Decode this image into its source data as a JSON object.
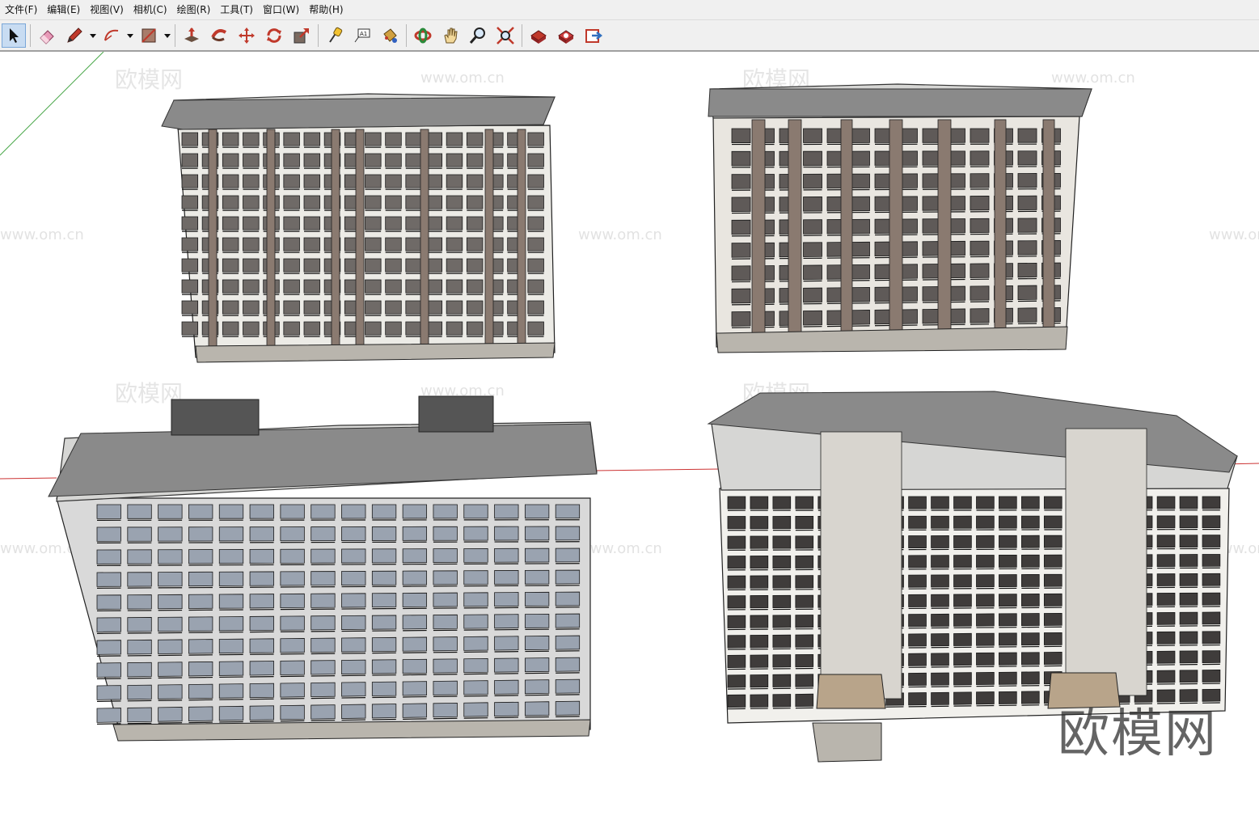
{
  "menu": [
    "文件(F)",
    "编辑(E)",
    "视图(V)",
    "相机(C)",
    "绘图(R)",
    "工具(T)",
    "窗口(W)",
    "帮助(H)"
  ],
  "toolbar": {
    "tools": [
      {
        "name": "select-icon",
        "active": true
      },
      {
        "name": "eraser-icon"
      },
      {
        "name": "pencil-icon",
        "dropdown": true
      },
      {
        "name": "arc-icon",
        "dropdown": true
      },
      {
        "name": "rectangle-icon",
        "dropdown": true
      },
      {
        "name": "push-pull-icon"
      },
      {
        "name": "follow-me-icon"
      },
      {
        "name": "move-icon"
      },
      {
        "name": "rotate-icon"
      },
      {
        "name": "scale-icon"
      },
      {
        "name": "tape-measure-icon"
      },
      {
        "name": "text-icon"
      },
      {
        "name": "paint-bucket-icon"
      },
      {
        "name": "orbit-icon"
      },
      {
        "name": "pan-icon"
      },
      {
        "name": "zoom-icon"
      },
      {
        "name": "zoom-extents-icon"
      },
      {
        "name": "warehouse-icon"
      },
      {
        "name": "extension-warehouse-icon"
      },
      {
        "name": "layout-send-icon"
      }
    ],
    "text_tool_label": "A1"
  },
  "watermarks": {
    "site": "www.om.cn",
    "brand": "欧模网"
  },
  "logo": "欧模网",
  "colors": {
    "roof_gray": "#8a8a8a",
    "facade_light": "#ecebe6",
    "facade_brown": "#8a7a70",
    "glass_blue": "#9aa3b0",
    "axis_red": "#cc3333",
    "axis_green": "#4aa84a"
  }
}
